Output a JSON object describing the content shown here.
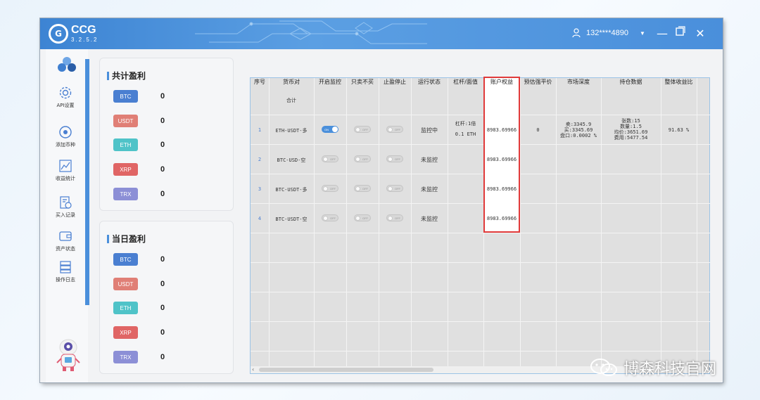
{
  "app": {
    "name": "CCG",
    "version": "3.2.5.2"
  },
  "user": {
    "phone": "132****4890"
  },
  "sidebar": {
    "items": [
      {
        "label": "API设置",
        "icon": "gear-icon"
      },
      {
        "label": "添加币种",
        "icon": "add-coin-icon"
      },
      {
        "label": "收益统计",
        "icon": "chart-icon"
      },
      {
        "label": "买入记录",
        "icon": "record-icon"
      },
      {
        "label": "资产状态",
        "icon": "wallet-icon"
      },
      {
        "label": "操作日志",
        "icon": "log-icon"
      }
    ]
  },
  "total_profit": {
    "title": "共计盈利",
    "coins": [
      {
        "name": "BTC",
        "value": "0",
        "color": "#4a7fd1"
      },
      {
        "name": "USDT",
        "value": "0",
        "color": "#e07f76"
      },
      {
        "name": "ETH",
        "value": "0",
        "color": "#4fc3c8"
      },
      {
        "name": "XRP",
        "value": "0",
        "color": "#e06565"
      },
      {
        "name": "TRX",
        "value": "0",
        "color": "#8c8fd6"
      }
    ]
  },
  "daily_profit": {
    "title": "当日盈利",
    "coins": [
      {
        "name": "BTC",
        "value": "0",
        "color": "#4a7fd1"
      },
      {
        "name": "USDT",
        "value": "0",
        "color": "#e07f76"
      },
      {
        "name": "ETH",
        "value": "0",
        "color": "#4fc3c8"
      },
      {
        "name": "XRP",
        "value": "0",
        "color": "#e06565"
      },
      {
        "name": "TRX",
        "value": "0",
        "color": "#8c8fd6"
      }
    ]
  },
  "table": {
    "headers": [
      "序号",
      "货币对",
      "开启监控",
      "只卖不买",
      "止盈停止",
      "运行状态",
      "杠杆/面值",
      "账户权益",
      "预估强平价",
      "市场深度",
      "持仓数据",
      "整体收益比"
    ],
    "total_label": "合计",
    "rows": [
      {
        "index": "1",
        "pair": "ETH-USDT-多",
        "monitor": "ON",
        "sell_only": "OFF",
        "tp_stop": "OFF",
        "status": "监控中",
        "leverage": "杠杆:1倍",
        "face": "0.1 ETH",
        "equity": "8983.69966",
        "liq_price": "0",
        "depth": [
          "卖:3345.9",
          "买:3345.69",
          "盘口:0.0002 %"
        ],
        "position": [
          "张数:15",
          "数量:1.5",
          "均价:3651.69",
          "费用:5477.54"
        ],
        "ratio": "91.63 %"
      },
      {
        "index": "2",
        "pair": "BTC-USD-空",
        "monitor": "OFF",
        "sell_only": "OFF",
        "tp_stop": "OFF",
        "status": "未监控",
        "leverage": "",
        "face": "",
        "equity": "8983.69966",
        "liq_price": "",
        "depth": [],
        "position": [],
        "ratio": ""
      },
      {
        "index": "3",
        "pair": "BTC-USDT-多",
        "monitor": "OFF",
        "sell_only": "OFF",
        "tp_stop": "OFF",
        "status": "未监控",
        "leverage": "",
        "face": "",
        "equity": "8983.69966",
        "liq_price": "",
        "depth": [],
        "position": [],
        "ratio": ""
      },
      {
        "index": "4",
        "pair": "BTC-USDT-空",
        "monitor": "OFF",
        "sell_only": "OFF",
        "tp_stop": "OFF",
        "status": "未监控",
        "leverage": "",
        "face": "",
        "equity": "8983.69966",
        "liq_price": "",
        "depth": [],
        "position": [],
        "ratio": ""
      }
    ]
  },
  "watermark": {
    "text": "博森科技官网"
  }
}
